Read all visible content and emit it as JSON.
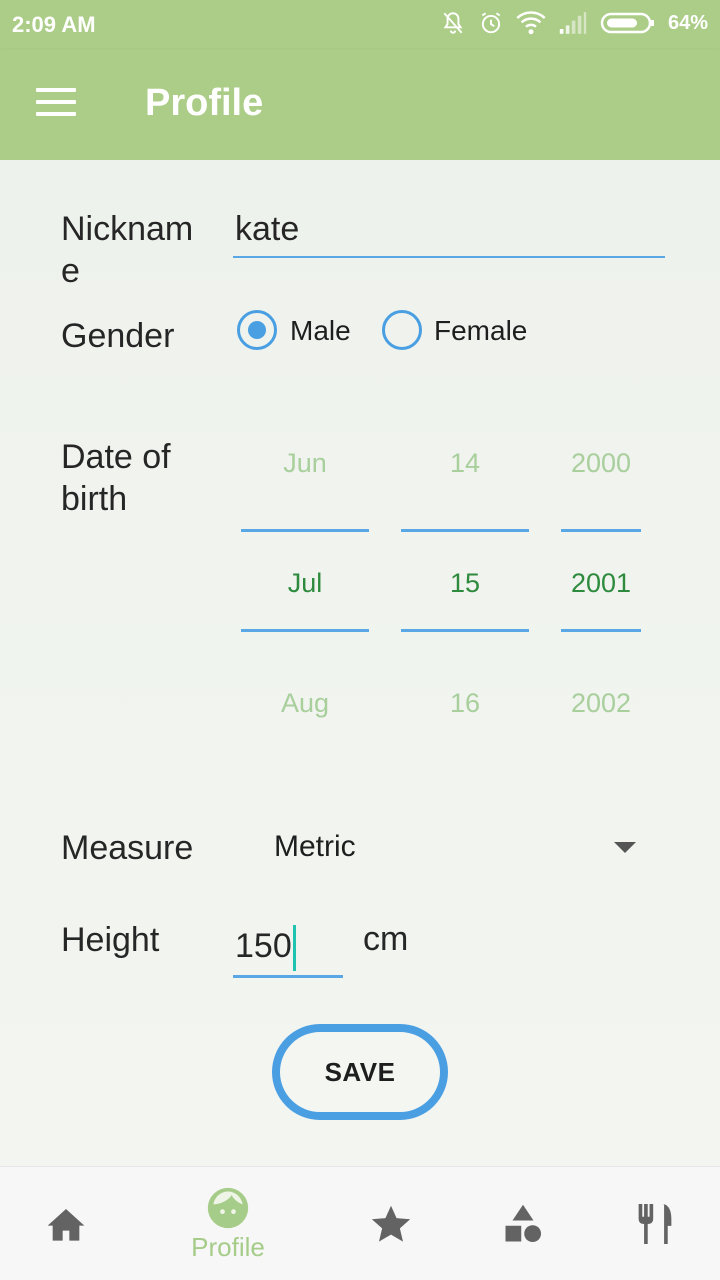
{
  "status_bar": {
    "time": "2:09 AM",
    "battery": "64%"
  },
  "app_bar": {
    "title": "Profile"
  },
  "form": {
    "nickname_label": "Nicknam\ne",
    "nickname_value": "kate",
    "gender_label": "Gender",
    "gender_options": [
      "Male",
      "Female"
    ],
    "gender_selected": "Male",
    "dob_label": "Date of\nbirth",
    "dob": {
      "month": {
        "prev": "Jun",
        "selected": "Jul",
        "next": "Aug"
      },
      "day": {
        "prev": "14",
        "selected": "15",
        "next": "16"
      },
      "year": {
        "prev": "2000",
        "selected": "2001",
        "next": "2002"
      }
    },
    "measure_label": "Measure",
    "measure_value": "Metric",
    "height_label": "Height",
    "height_value": "150",
    "height_unit": "cm",
    "save_label": "SAVE"
  },
  "bottom_nav": {
    "active": "Profile",
    "items": [
      "home-icon",
      "profile-face-icon",
      "star-icon",
      "shapes-icon",
      "fork-knife-icon"
    ],
    "active_label": "Profile"
  },
  "colors": {
    "accent_green": "#accd88",
    "accent_blue": "#4a9fe3",
    "selected_green": "#2e8b3d"
  }
}
